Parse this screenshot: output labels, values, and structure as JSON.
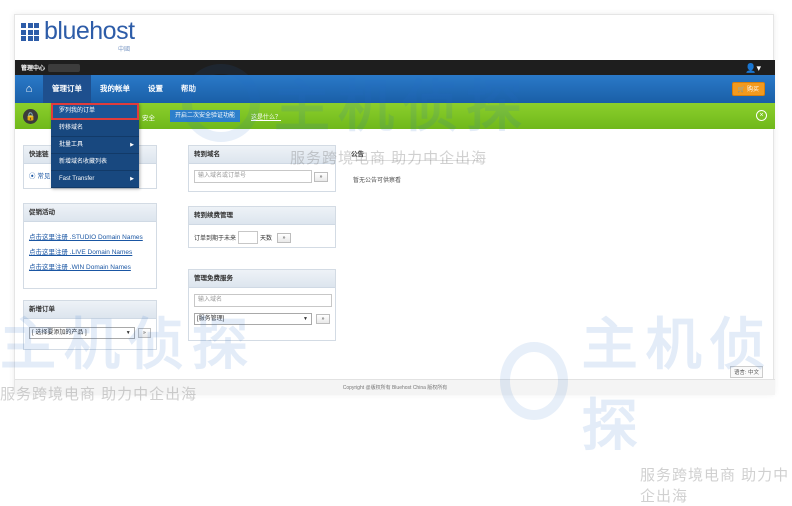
{
  "header": {
    "logo_text": "bluehost",
    "logo_sub": "中國"
  },
  "adminbar": {
    "title": "管理中心"
  },
  "nav": {
    "items": [
      {
        "label": "管理订单"
      },
      {
        "label": "我的帐单"
      },
      {
        "label": "设置"
      },
      {
        "label": "帮助"
      }
    ],
    "cart_label": "购买"
  },
  "dropdown": {
    "items": [
      {
        "label": "罗列我的订单"
      },
      {
        "label": "转移域名"
      },
      {
        "label": "批量工具"
      },
      {
        "label": "新增域名收藏列表"
      },
      {
        "label": "Fast Transfer"
      }
    ]
  },
  "security": {
    "text": "安全",
    "button_label": "开启二次安全验证功能",
    "link_label": "这是什么？"
  },
  "quick": {
    "title": "快速链",
    "item": "常见"
  },
  "promo": {
    "title": "促销活动",
    "links": [
      "点击这里注册 .STUDIO Domain Names",
      "点击这里注册 .LIVE Domain Names",
      "点击这里注册 .WIN Domain Names"
    ]
  },
  "new_order": {
    "title": "新增订单",
    "select_value": "[ 选择要添加的产品 ]",
    "go_label": "»"
  },
  "transfer": {
    "title": "转到域名",
    "placeholder": "输入域名或订单号",
    "go_label": "»"
  },
  "renewal": {
    "title": "转到续费管理",
    "label_prefix": "订单到期于未来",
    "label_suffix": "天数",
    "go_label": "»"
  },
  "free_service": {
    "title": "管理免费服务",
    "placeholder": "输入域名",
    "select_value": "[服务管理]",
    "go_label": "»"
  },
  "notice": {
    "title": "公告",
    "text": "暂无公告可供察看"
  },
  "footer": {
    "text": "Copyright @版权所有 Bluehost China 版权所有",
    "lang": "语言: 中文"
  },
  "watermark": {
    "brand": "主机侦探",
    "slogan": "服务跨境电商 助力中企出海"
  },
  "colors": {
    "nav_blue": "#1a5fa7",
    "security_green": "#7cc423",
    "highlight_red": "#e03c3c",
    "cart_orange": "#f39a1e"
  }
}
